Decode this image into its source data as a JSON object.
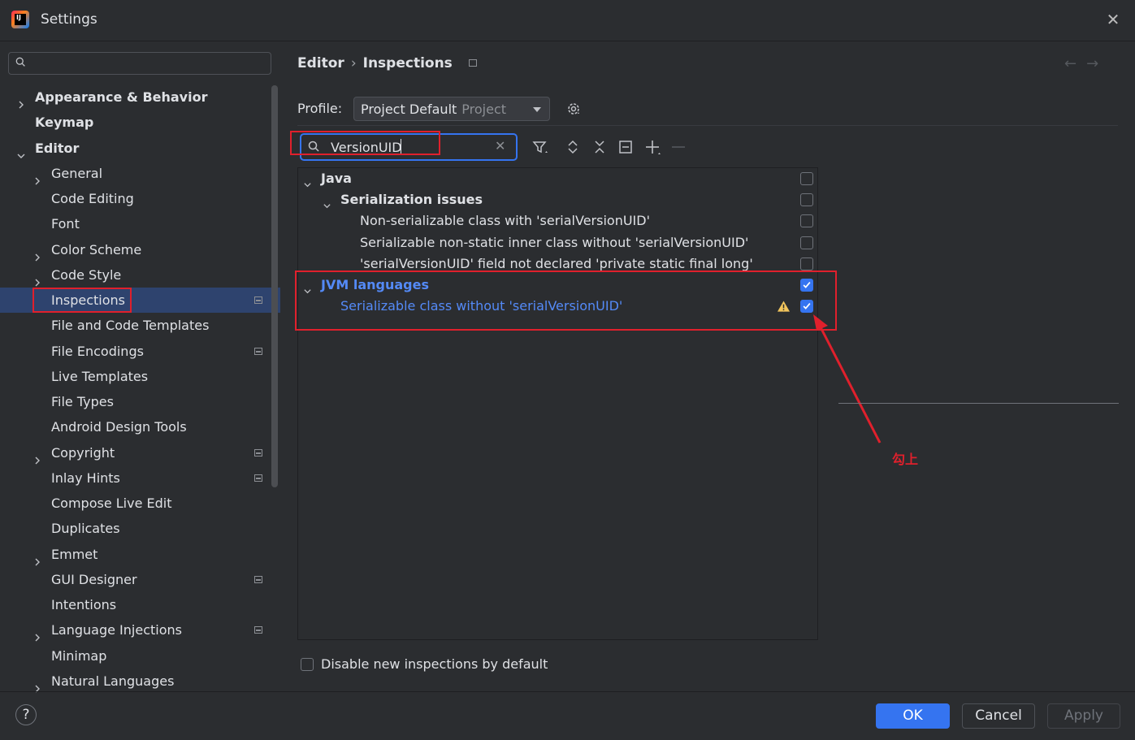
{
  "window": {
    "title": "Settings"
  },
  "sidebar": {
    "search_placeholder": "",
    "items": [
      {
        "label": "Appearance & Behavior",
        "level": 0,
        "expandable": true,
        "expanded": false,
        "bold": true
      },
      {
        "label": "Keymap",
        "level": 0,
        "expandable": false,
        "bold": true
      },
      {
        "label": "Editor",
        "level": 0,
        "expandable": true,
        "expanded": true,
        "bold": true
      },
      {
        "label": "General",
        "level": 1,
        "expandable": true
      },
      {
        "label": "Code Editing",
        "level": 1
      },
      {
        "label": "Font",
        "level": 1
      },
      {
        "label": "Color Scheme",
        "level": 1,
        "expandable": true
      },
      {
        "label": "Code Style",
        "level": 1,
        "expandable": true
      },
      {
        "label": "Inspections",
        "level": 1,
        "selected": true,
        "project_icon": true
      },
      {
        "label": "File and Code Templates",
        "level": 1
      },
      {
        "label": "File Encodings",
        "level": 1,
        "project_icon": true
      },
      {
        "label": "Live Templates",
        "level": 1
      },
      {
        "label": "File Types",
        "level": 1
      },
      {
        "label": "Android Design Tools",
        "level": 1
      },
      {
        "label": "Copyright",
        "level": 1,
        "expandable": true,
        "project_icon": true
      },
      {
        "label": "Inlay Hints",
        "level": 1,
        "project_icon": true
      },
      {
        "label": "Compose Live Edit",
        "level": 1
      },
      {
        "label": "Duplicates",
        "level": 1
      },
      {
        "label": "Emmet",
        "level": 1,
        "expandable": true
      },
      {
        "label": "GUI Designer",
        "level": 1,
        "project_icon": true
      },
      {
        "label": "Intentions",
        "level": 1
      },
      {
        "label": "Language Injections",
        "level": 1,
        "expandable": true,
        "project_icon": true
      },
      {
        "label": "Minimap",
        "level": 1
      },
      {
        "label": "Natural Languages",
        "level": 1,
        "expandable": true
      }
    ]
  },
  "breadcrumb": {
    "parent": "Editor",
    "separator": "›",
    "current": "Inspections"
  },
  "profile": {
    "label": "Profile:",
    "value": "Project Default",
    "scope": "Project"
  },
  "inspection_search": {
    "value": "VersionUID"
  },
  "inspections": [
    {
      "label": "Java",
      "level": 0,
      "expanded": true,
      "bold": true,
      "checked": false
    },
    {
      "label": "Serialization issues",
      "level": 1,
      "expanded": true,
      "bold": true,
      "checked": false
    },
    {
      "label": "Non-serializable class with 'serialVersionUID'",
      "level": 2,
      "checked": false
    },
    {
      "label": "Serializable non-static inner class without 'serialVersionUID'",
      "level": 2,
      "checked": false
    },
    {
      "label": "'serialVersionUID' field not declared 'private static final long'",
      "level": 2,
      "checked": false
    },
    {
      "label": "JVM languages",
      "level": 0,
      "expanded": true,
      "bold": true,
      "blue": true,
      "checked": true
    },
    {
      "label": "Serializable class without 'serialVersionUID'",
      "level": 1,
      "blue": true,
      "warning": true,
      "checked": true
    }
  ],
  "annotation": {
    "text": "勾上"
  },
  "disable_new": {
    "label": "Disable new inspections by default",
    "checked": false
  },
  "footer": {
    "help": "?",
    "ok": "OK",
    "cancel": "Cancel",
    "apply": "Apply"
  },
  "colors": {
    "accent": "#3574f0",
    "selection": "#2e436e",
    "highlight_text": "#548af7",
    "annotation": "#e0202c",
    "background": "#2b2d30"
  }
}
